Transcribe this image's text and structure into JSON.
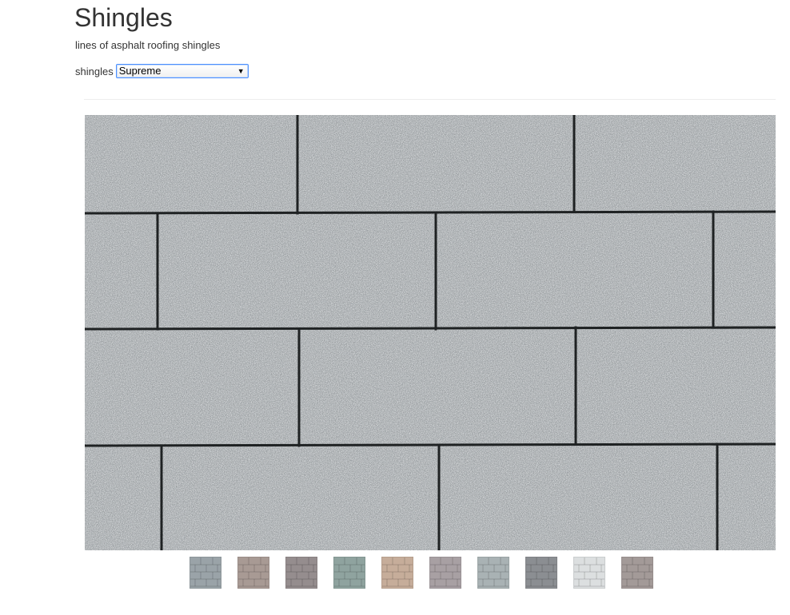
{
  "header": {
    "title": "Shingles",
    "subtitle": "lines of asphalt roofing shingles"
  },
  "selector": {
    "label": "shingles",
    "selected": "Supreme"
  },
  "viewer": {
    "icon": "shingle-texture-image",
    "base_color": "#a9aeb1",
    "seam_color": "#1f2223"
  },
  "thumbnails": [
    {
      "color": "#9aa3a8",
      "icon": "shingle-swatch"
    },
    {
      "color": "#a89a94",
      "icon": "shingle-swatch"
    },
    {
      "color": "#958d8e",
      "icon": "shingle-swatch"
    },
    {
      "color": "#8fa39f",
      "icon": "shingle-swatch"
    },
    {
      "color": "#c6ad9a",
      "icon": "shingle-swatch"
    },
    {
      "color": "#a8a0a3",
      "icon": "shingle-swatch"
    },
    {
      "color": "#a9b2b4",
      "icon": "shingle-swatch"
    },
    {
      "color": "#8b8e92",
      "icon": "shingle-swatch"
    },
    {
      "color": "#dcdfe0",
      "icon": "shingle-swatch"
    },
    {
      "color": "#a39a98",
      "icon": "shingle-swatch"
    }
  ]
}
